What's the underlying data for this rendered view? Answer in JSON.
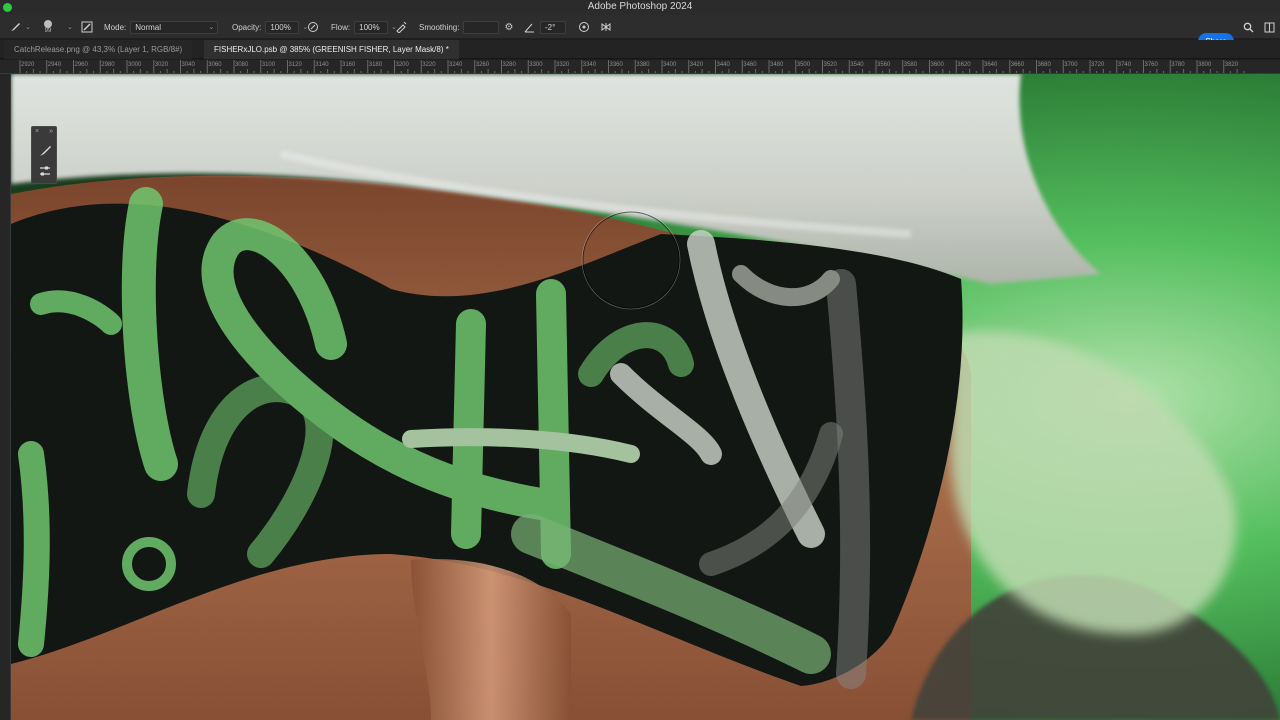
{
  "app": {
    "title": "Adobe Photoshop 2024"
  },
  "options": {
    "brush_size": "99",
    "mode_label": "Mode:",
    "mode_value": "Normal",
    "opacity_label": "Opacity:",
    "opacity_value": "100%",
    "flow_label": "Flow:",
    "flow_value": "100%",
    "smoothing_label": "Smoothing:",
    "smoothing_value": "",
    "angle_value": "-2°",
    "share_label": "Share"
  },
  "tabs": [
    {
      "label": "CatchRelease.png @ 43,3% (Layer 1, RGB/8#)"
    },
    {
      "label": "FISHERxJLO.psb @ 385% (GREENISH FISHER, Layer Mask/8) *"
    }
  ],
  "ruler": {
    "ticks": [
      "2920",
      "2940",
      "2960",
      "2980",
      "3000",
      "3020",
      "3040",
      "3060",
      "3080",
      "3100",
      "3120",
      "3140",
      "3160",
      "3180",
      "3200",
      "3220",
      "3240",
      "3260",
      "3280",
      "3300",
      "3320",
      "3340",
      "3360",
      "3380",
      "3400",
      "3420",
      "3440",
      "3460",
      "3480",
      "3500",
      "3520",
      "3540",
      "3560",
      "3580",
      "3600",
      "3620",
      "3640",
      "3660",
      "3680",
      "3700",
      "3720",
      "3740",
      "3760",
      "3780",
      "3800",
      "3820"
    ]
  },
  "colors": {
    "accent": "#1473e6",
    "traffic_green": "#2fc840",
    "canvas_green": "#4cc25a",
    "skin": "#a8623e"
  },
  "icons": {
    "brush_tool": "brush-icon",
    "brush_settings": "brush-settings-icon",
    "pressure_opacity": "pressure-opacity-icon",
    "airbrush": "airbrush-icon",
    "settings": "gear-icon",
    "angle": "angle-icon",
    "pressure_size": "pressure-size-icon",
    "symmetry": "butterfly-icon",
    "search": "search-icon",
    "panels": "panels-icon"
  }
}
